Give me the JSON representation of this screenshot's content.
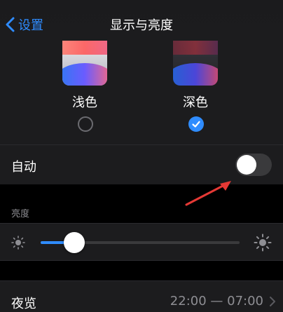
{
  "nav": {
    "back_label": "设置",
    "title": "显示与亮度"
  },
  "appearance": {
    "options": [
      {
        "label": "浅色",
        "selected": false
      },
      {
        "label": "深色",
        "selected": true
      }
    ]
  },
  "auto": {
    "label": "自动",
    "enabled": false
  },
  "brightness": {
    "section_label": "亮度",
    "level": 0.17
  },
  "night_shift": {
    "label": "夜览",
    "value": "22:00 — 07:00"
  },
  "colors": {
    "accent": "#2f8cff",
    "annotation": "#e53935"
  }
}
